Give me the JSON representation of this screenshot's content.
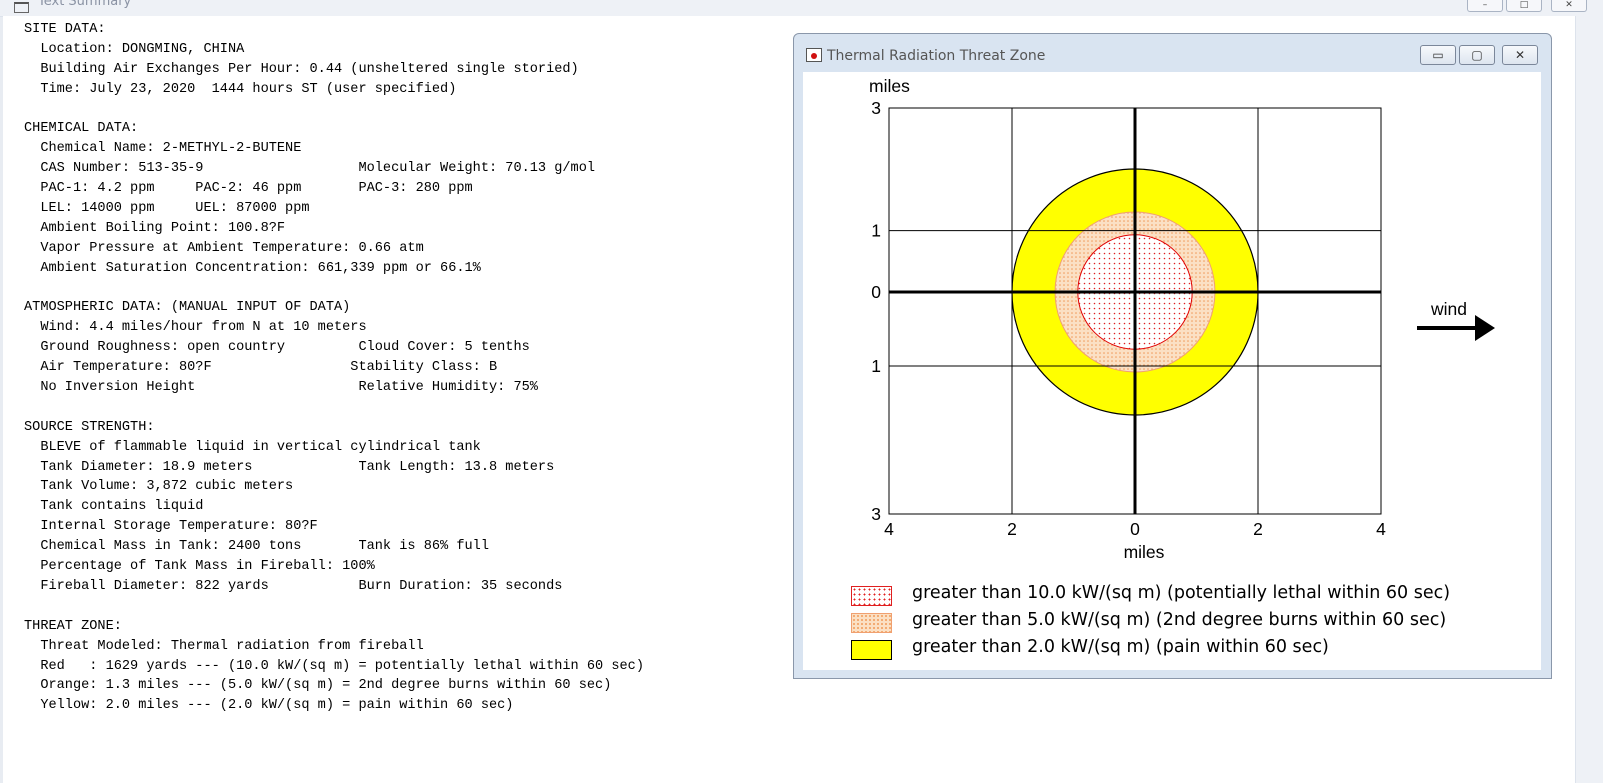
{
  "main_window": {
    "title": "Text Summary",
    "controls": {
      "minimize": "–",
      "maximize": "□",
      "close": "✕"
    }
  },
  "summary_lines": [
    "SITE DATA:",
    "  Location: DONGMING, CHINA",
    "  Building Air Exchanges Per Hour: 0.44 (unsheltered single storied)",
    "  Time: July 23, 2020  1444 hours ST (user specified)",
    "",
    "CHEMICAL DATA:",
    "  Chemical Name: 2-METHYL-2-BUTENE",
    "  CAS Number: 513-35-9                   Molecular Weight: 70.13 g/mol",
    "  PAC-1: 4.2 ppm     PAC-2: 46 ppm       PAC-3: 280 ppm",
    "  LEL: 14000 ppm     UEL: 87000 ppm",
    "  Ambient Boiling Point: 100.8?F",
    "  Vapor Pressure at Ambient Temperature: 0.66 atm",
    "  Ambient Saturation Concentration: 661,339 ppm or 66.1%",
    "",
    "ATMOSPHERIC DATA: (MANUAL INPUT OF DATA)",
    "  Wind: 4.4 miles/hour from N at 10 meters",
    "  Ground Roughness: open country         Cloud Cover: 5 tenths",
    "  Air Temperature: 80?F                 Stability Class: B",
    "  No Inversion Height                    Relative Humidity: 75%",
    "",
    "SOURCE STRENGTH:",
    "  BLEVE of flammable liquid in vertical cylindrical tank",
    "  Tank Diameter: 18.9 meters             Tank Length: 13.8 meters",
    "  Tank Volume: 3,872 cubic meters",
    "  Tank contains liquid",
    "  Internal Storage Temperature: 80?F",
    "  Chemical Mass in Tank: 2400 tons       Tank is 86% full",
    "  Percentage of Tank Mass in Fireball: 100%",
    "  Fireball Diameter: 822 yards           Burn Duration: 35 seconds",
    "",
    "THREAT ZONE:",
    "  Threat Modeled: Thermal radiation from fireball",
    "  Red   : 1629 yards --- (10.0 kW/(sq m) = potentially lethal within 60 sec)",
    "  Orange: 1.3 miles --- (5.0 kW/(sq m) = 2nd degree burns within 60 sec)",
    "  Yellow: 2.0 miles --- (2.0 kW/(sq m) = pain within 60 sec)"
  ],
  "threat_window": {
    "title": "Thermal Radiation Threat Zone",
    "controls": {
      "minimize": "▭",
      "maximize": "▢",
      "close": "✕"
    }
  },
  "chart_data": {
    "type": "other",
    "ylabel": "miles",
    "xlabel": "miles",
    "xlim": [
      -4,
      4
    ],
    "ylim": [
      -3,
      3
    ],
    "x_tick_labels": [
      {
        "value": -4,
        "label": "4"
      },
      {
        "value": -2,
        "label": "2"
      },
      {
        "value": 0,
        "label": "0"
      },
      {
        "value": 2,
        "label": "2"
      },
      {
        "value": 4,
        "label": "4"
      }
    ],
    "y_tick_labels": [
      {
        "value": 3,
        "label": "3"
      },
      {
        "value": 1,
        "label": "1"
      },
      {
        "value": 0,
        "label": "0"
      },
      {
        "value": -1,
        "label": "1"
      },
      {
        "value": -3,
        "label": "3"
      }
    ],
    "grid": true,
    "wind_label": "wind",
    "wind_direction": "east",
    "zones": [
      {
        "name": "Yellow",
        "radius_miles": 2.0,
        "color": "#ffff00",
        "edge": "#000000",
        "pattern": "solid"
      },
      {
        "name": "Orange",
        "radius_miles": 1.3,
        "color": "#f8d8b0",
        "edge": "#f0a070",
        "pattern": "dotted"
      },
      {
        "name": "Red",
        "radius_miles": 0.93,
        "color": "#ffffff",
        "edge": "#e00000",
        "pattern": "dotted-red"
      }
    ],
    "legend": [
      {
        "text": "greater than 10.0 kW/(sq m) (potentially lethal within 60 sec)",
        "swatch": "red-dots"
      },
      {
        "text": "greater than 5.0 kW/(sq m) (2nd degree burns within 60 sec)",
        "swatch": "orange-dots"
      },
      {
        "text": "greater than 2.0 kW/(sq m) (pain within 60 sec)",
        "swatch": "yellow"
      }
    ]
  }
}
